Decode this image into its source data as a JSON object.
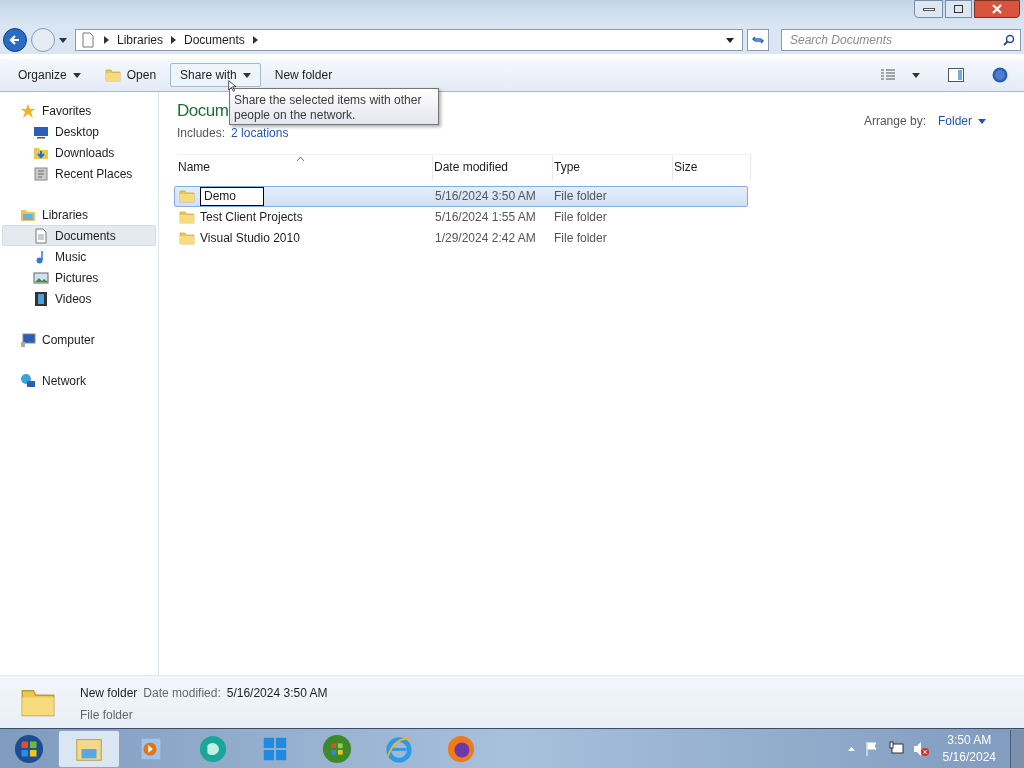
{
  "address_bar": {
    "crumbs": [
      "Libraries",
      "Documents"
    ]
  },
  "search": {
    "placeholder": "Search Documents"
  },
  "toolbar": {
    "buttons": [
      {
        "label": "Organize",
        "dropdown": true,
        "hovered": false
      },
      {
        "label": "Open",
        "dropdown": false,
        "hovered": false
      },
      {
        "label": "Share with",
        "dropdown": true,
        "hovered": true
      },
      {
        "label": "New folder",
        "dropdown": false,
        "hovered": false
      }
    ]
  },
  "tooltip": "Share the selected items with other people on the network.",
  "sidebar": {
    "groups": [
      {
        "label": "Favorites",
        "children": [
          {
            "label": "Desktop",
            "selected": false
          },
          {
            "label": "Downloads",
            "selected": false
          },
          {
            "label": "Recent Places",
            "selected": false
          }
        ]
      },
      {
        "label": "Libraries",
        "children": [
          {
            "label": "Documents",
            "selected": true
          },
          {
            "label": "Music",
            "selected": false
          },
          {
            "label": "Pictures",
            "selected": false
          },
          {
            "label": "Videos",
            "selected": false
          }
        ]
      },
      {
        "label": "Computer"
      },
      {
        "label": "Network"
      }
    ]
  },
  "library": {
    "title": "Docum",
    "includes_label": "Includes:",
    "includes_link": "2 locations",
    "arrange_label": "Arrange by:",
    "arrange_value": "Folder"
  },
  "table": {
    "columns": [
      {
        "label": "Name",
        "sorted": true
      },
      {
        "label": "Date modified",
        "sorted": false
      },
      {
        "label": "Type",
        "sorted": false
      },
      {
        "label": "Size",
        "sorted": false
      }
    ],
    "rows": [
      {
        "name": "Demo",
        "date": "5/16/2024 3:50 AM",
        "type": "File folder",
        "selected": true,
        "editing": true
      },
      {
        "name": "Test Client Projects",
        "date": "5/16/2024 1:55 AM",
        "type": "File folder",
        "selected": false,
        "editing": false
      },
      {
        "name": "Visual Studio 2010",
        "date": "1/29/2024 2:42 AM",
        "type": "File folder",
        "selected": false,
        "editing": false
      }
    ]
  },
  "details": {
    "name": "New folder",
    "date_label": "Date modified:",
    "date": "5/16/2024 3:50 AM",
    "type": "File folder"
  },
  "taskbar": {
    "items": [
      {
        "selected": false
      },
      {
        "selected": true
      },
      {
        "selected": false
      },
      {
        "selected": false
      },
      {
        "selected": false
      },
      {
        "selected": false
      },
      {
        "selected": false
      },
      {
        "selected": false
      }
    ],
    "clock": {
      "time": "3:50 AM",
      "date": "5/16/2024"
    }
  }
}
